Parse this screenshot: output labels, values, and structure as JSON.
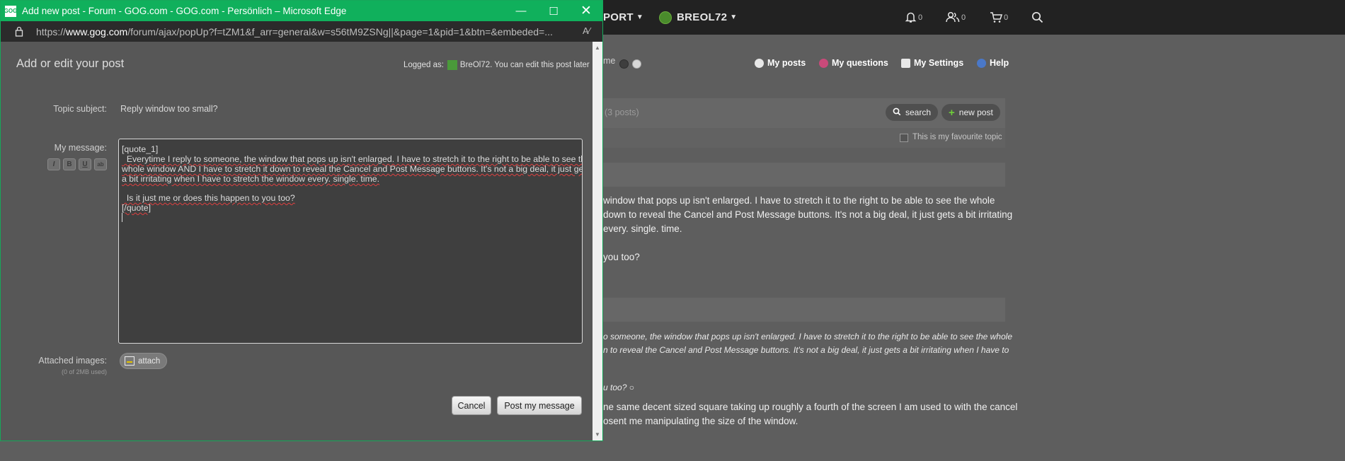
{
  "popup": {
    "title": "Add new post - Forum - GOG.com - GOG.com - Persönlich – Microsoft Edge",
    "url_prefix": "https://",
    "url_domain": "www.gog.com",
    "url_path": "/forum/ajax/popUp?f=tZM1&f_arr=general&w=s56tM9ZSNg||&page=1&pid=1&btn=&embeded=...",
    "heading": "Add or edit your post",
    "logged_as_label": "Logged as:",
    "logged_user": "BreOl72",
    "logged_note": ". You can edit this post later",
    "topic_label": "Topic subject:",
    "topic_value": "Reply window too small?",
    "message_label": "My message:",
    "message_lines": {
      "l1": "[quote_1]",
      "l2": "  Everytime I reply to someone, the window that pops up isn't enlarged. I have to stretch it to the right to be able to see the",
      "l3": "whole window AND I have to stretch it down to reveal the Cancel and Post Message buttons. It's not a big deal, it just gets",
      "l4": "a bit irritating when I have to stretch the window every. single. time.",
      "l5": "  Is it just me or does this happen to you too?",
      "l6": "[/quote]"
    },
    "format_buttons": [
      "I",
      "B",
      "U",
      "ab"
    ],
    "attached_label": "Attached images:",
    "attached_sub": "(0 of 2MB used)",
    "attach_button": "attach",
    "cancel_button": "Cancel",
    "post_button": "Post my message"
  },
  "background": {
    "topbar": {
      "support": "PORT",
      "user": "BREOL72",
      "notifications": "0",
      "friends": "0",
      "cart": "0"
    },
    "nav": {
      "theme_label": "me",
      "my_posts": "My posts",
      "my_questions": "My questions",
      "my_settings": "My Settings",
      "help": "Help"
    },
    "topic_posts": "(3 posts)",
    "search_button": "search",
    "new_post_button": "new post",
    "favourite_label": "This is my favourite topic",
    "post1": {
      "l1": "window that pops up isn't enlarged. I have to stretch it to the right to be able to see the whole",
      "l2": "down to reveal the Cancel and Post Message buttons. It's not a big deal, it just gets a bit irritating",
      "l3": "every. single. time.",
      "l4": "you too?"
    },
    "post2": {
      "q1": "o someone, the window that pops up isn't enlarged. I have to stretch it to the right to be able to see the whole",
      "q2": "n to reveal the Cancel and Post Message buttons. It's not a big deal, it just gets a bit irritating when I have to",
      "q3": "u too?",
      "l1": "ne same decent sized square taking up roughly a fourth of the screen I am used to with the cancel",
      "l2": "osent me manipulating the size of the window."
    }
  },
  "colors": {
    "edge_green": "#10b05c",
    "topbar_bg": "#222222",
    "page_bg": "#5e5e5e"
  }
}
